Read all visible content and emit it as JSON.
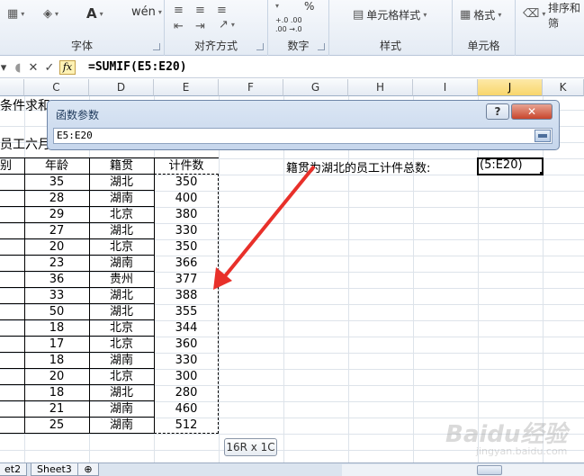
{
  "ribbon": {
    "groups": [
      {
        "label": "字体"
      },
      {
        "label": "对齐方式"
      },
      {
        "label": "数字"
      },
      {
        "label": "样式"
      },
      {
        "label": "单元格"
      }
    ],
    "buttons": {
      "cell_styles": "单元格样式",
      "format": "格式",
      "sort_filter": "排序和筛",
      "font_a": "A",
      "wen": "wén",
      "percent": "%",
      "decimals_up": "+.0 .00",
      "decimals_down": ".00 →.0"
    }
  },
  "formula_bar": {
    "fx": "fx",
    "formula": "=SUMIF(E5:E20)"
  },
  "columns": [
    "C",
    "D",
    "E",
    "F",
    "G",
    "H",
    "I",
    "J",
    "K"
  ],
  "selected_column": "J",
  "sheet": {
    "partial_title": "条件求和",
    "partial_subtitle": "员工六月",
    "partial_header_b": "别",
    "headers": {
      "age": "年龄",
      "origin": "籍贯",
      "count": "计件数"
    },
    "rows": [
      {
        "age": "35",
        "origin": "湖北",
        "count": "350"
      },
      {
        "age": "28",
        "origin": "湖南",
        "count": "400"
      },
      {
        "age": "29",
        "origin": "北京",
        "count": "380"
      },
      {
        "age": "27",
        "origin": "湖北",
        "count": "330"
      },
      {
        "age": "20",
        "origin": "北京",
        "count": "350"
      },
      {
        "age": "23",
        "origin": "湖南",
        "count": "366"
      },
      {
        "age": "36",
        "origin": "贵州",
        "count": "377"
      },
      {
        "age": "33",
        "origin": "湖北",
        "count": "388"
      },
      {
        "age": "50",
        "origin": "湖北",
        "count": "355"
      },
      {
        "age": "18",
        "origin": "北京",
        "count": "344"
      },
      {
        "age": "17",
        "origin": "北京",
        "count": "360"
      },
      {
        "age": "18",
        "origin": "湖南",
        "count": "330"
      },
      {
        "age": "20",
        "origin": "北京",
        "count": "300"
      },
      {
        "age": "18",
        "origin": "湖北",
        "count": "280"
      },
      {
        "age": "21",
        "origin": "湖南",
        "count": "460"
      },
      {
        "age": "25",
        "origin": "湖南",
        "count": "512"
      }
    ],
    "label_g": "籍贯为湖北的员工计件总数:",
    "active_cell_text": "(5:E20)"
  },
  "dialog": {
    "title": "函数参数",
    "help": "?",
    "close": "✕",
    "input_value": "E5:E20"
  },
  "tooltip": "16R x 1C",
  "sheet_tabs": [
    "et2",
    "Sheet3"
  ],
  "watermark": {
    "brand": "Baidu经验",
    "url": "jingyan.baidu.com"
  },
  "colors": {
    "arrow": "#e8302a",
    "selected_header": "#f8d66c"
  }
}
